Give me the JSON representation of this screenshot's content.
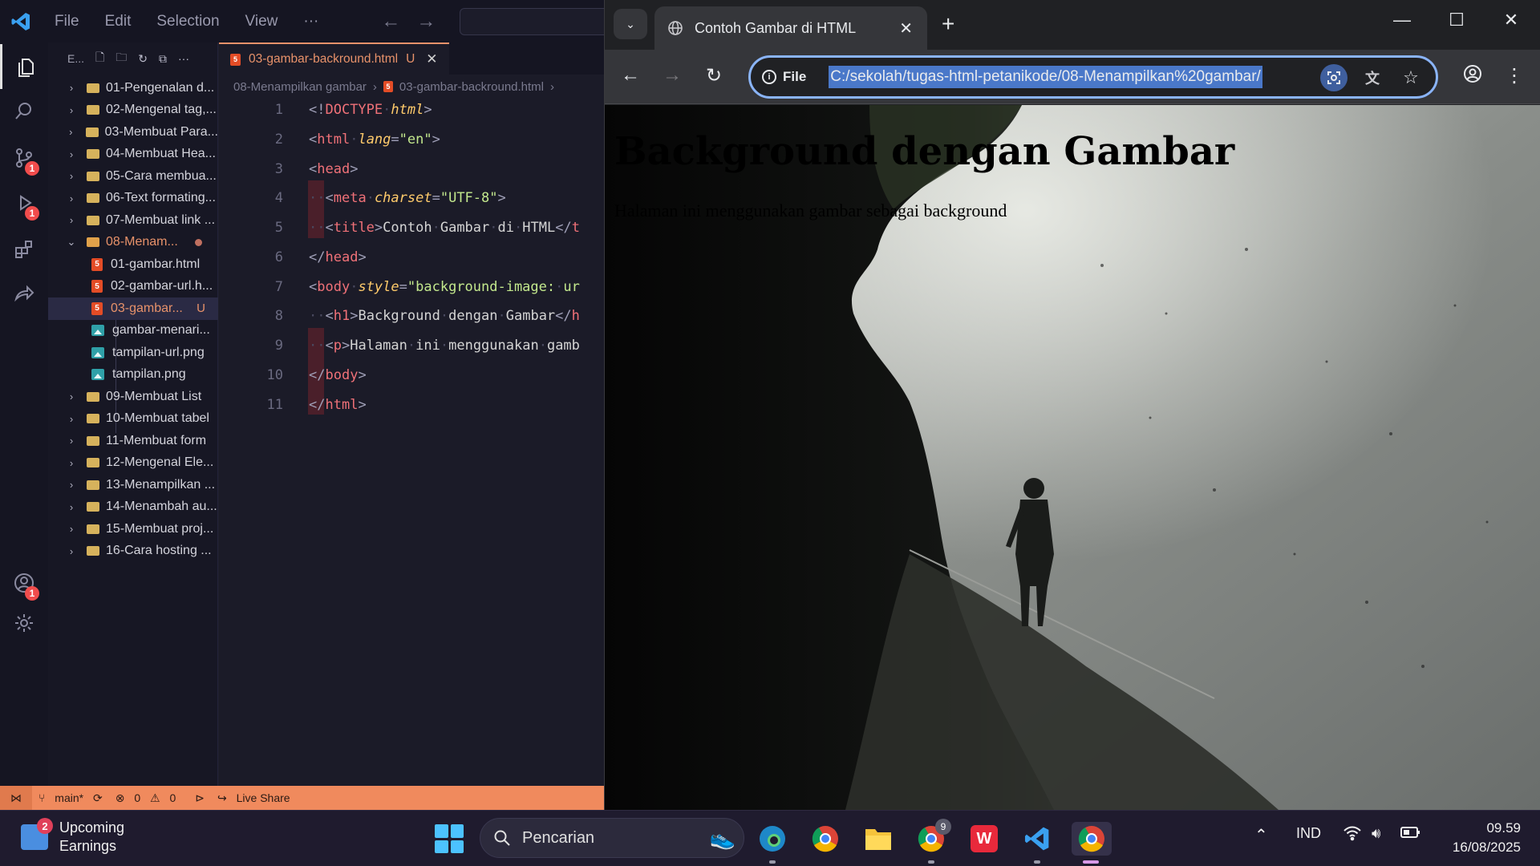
{
  "vscode": {
    "menu": [
      "File",
      "Edit",
      "Selection",
      "View",
      "···"
    ],
    "explorer_title": "E...",
    "activity_badges": {
      "source_control": "1",
      "run": "1",
      "accounts": "1"
    },
    "tree": [
      {
        "label": "01-Pengenalan d...",
        "type": "folder"
      },
      {
        "label": "02-Mengenal tag,...",
        "type": "folder"
      },
      {
        "label": "03-Membuat Para...",
        "type": "folder"
      },
      {
        "label": "04-Membuat Hea...",
        "type": "folder"
      },
      {
        "label": "05-Cara membua...",
        "type": "folder"
      },
      {
        "label": "06-Text formating...",
        "type": "folder"
      },
      {
        "label": "07-Membuat link ...",
        "type": "folder"
      },
      {
        "label": "08-Menam...",
        "type": "folder-open"
      },
      {
        "label": "01-gambar.html",
        "type": "html"
      },
      {
        "label": "02-gambar-url.h...",
        "type": "html"
      },
      {
        "label": "03-gambar...",
        "type": "html",
        "status": "U"
      },
      {
        "label": "gambar-menari...",
        "type": "image"
      },
      {
        "label": "tampilan-url.png",
        "type": "image"
      },
      {
        "label": "tampilan.png",
        "type": "image"
      },
      {
        "label": "09-Membuat List",
        "type": "folder"
      },
      {
        "label": "10-Membuat tabel",
        "type": "folder"
      },
      {
        "label": "11-Membuat form",
        "type": "folder"
      },
      {
        "label": "12-Mengenal Ele...",
        "type": "folder"
      },
      {
        "label": "13-Menampilkan ...",
        "type": "folder"
      },
      {
        "label": "14-Menambah au...",
        "type": "folder"
      },
      {
        "label": "15-Membuat proj...",
        "type": "folder"
      },
      {
        "label": "16-Cara hosting ...",
        "type": "folder"
      }
    ],
    "tab": {
      "label": "03-gambar-backround.html",
      "status": "U",
      "html_badge": "5"
    },
    "breadcrumb": [
      "08-Menampilkan gambar",
      "03-gambar-backround.html"
    ],
    "line_numbers": [
      "1",
      "2",
      "3",
      "4",
      "5",
      "6",
      "7",
      "8",
      "9",
      "10",
      "11"
    ],
    "status": {
      "branch": "main*",
      "errors": "0",
      "warnings": "0",
      "live_share": "Live Share"
    }
  },
  "chrome": {
    "tab_title": "Contoh Gambar di HTML",
    "scheme_label": "File",
    "url": "C:/sekolah/tugas-html-petanikode/08-Menampilkan%20gambar/",
    "page": {
      "heading": "Background dengan Gambar",
      "paragraph": "Halaman ini menggunakan gambar sebagai background"
    }
  },
  "taskbar": {
    "widget_badge": "2",
    "widget_line1": "Upcoming",
    "widget_line2": "Earnings",
    "search_placeholder": "Pencarian",
    "chrome_badge": "9",
    "language": "IND",
    "time": "09.59",
    "date": "16/08/2025"
  },
  "colors": {
    "accent_orange": "#f08a5d",
    "omnibox_focus": "#8ab4f8",
    "url_highlight": "#4a78c9"
  }
}
